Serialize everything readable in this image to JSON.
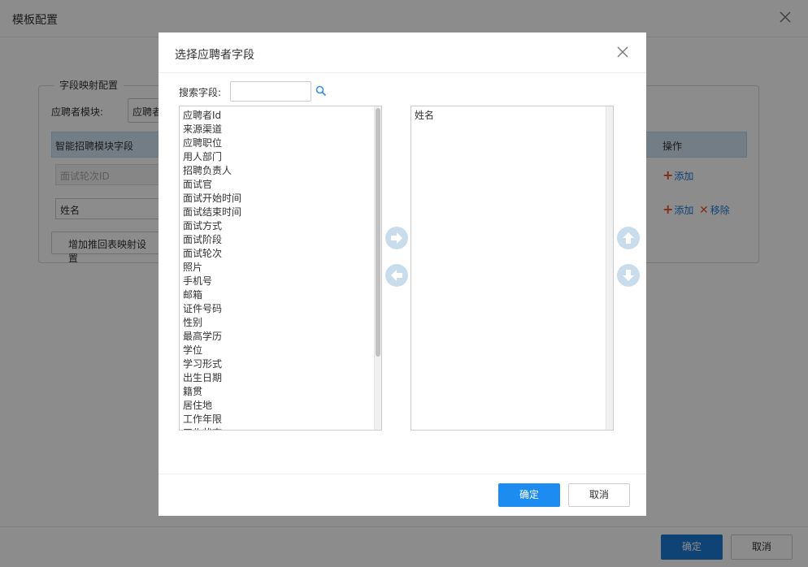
{
  "background": {
    "title": "模板配置",
    "legend": "字段映射配置",
    "module_label": "应聘者模块:",
    "module_value": "应聘者",
    "table_headers": [
      "智能招聘模块字段",
      "操作"
    ],
    "rows": [
      {
        "field": "面试轮次ID",
        "actions": [
          "添加"
        ]
      },
      {
        "field": "姓名",
        "actions": [
          "添加",
          "移除"
        ]
      }
    ],
    "add_row_button": "增加推回表映射设置",
    "ok": "确定",
    "cancel": "取消"
  },
  "modal": {
    "title": "选择应聘者字段",
    "search_label": "搜索字段:",
    "search_value": "",
    "available_fields": [
      "应聘者Id",
      "来源渠道",
      "应聘职位",
      "用人部门",
      "招聘负责人",
      "面试官",
      "面试开始时间",
      "面试结束时间",
      "面试方式",
      "面试阶段",
      "面试轮次",
      "照片",
      "手机号",
      "邮箱",
      "证件号码",
      "性别",
      "最高学历",
      "学位",
      "学习形式",
      "出生日期",
      "籍贯",
      "居住地",
      "工作年限",
      "工作状态"
    ],
    "selected_fields": [
      "姓名"
    ],
    "confirm": "确定",
    "cancel": "取消"
  },
  "colors": {
    "primary": "#1d8cf0",
    "circle_button": "#c9dcec",
    "overlay": "rgba(0,0,0,0.45)"
  },
  "icons": [
    "close-icon",
    "search-icon",
    "arrow-right-icon",
    "arrow-left-icon",
    "arrow-up-icon",
    "arrow-down-icon",
    "plus-icon",
    "x-icon"
  ]
}
